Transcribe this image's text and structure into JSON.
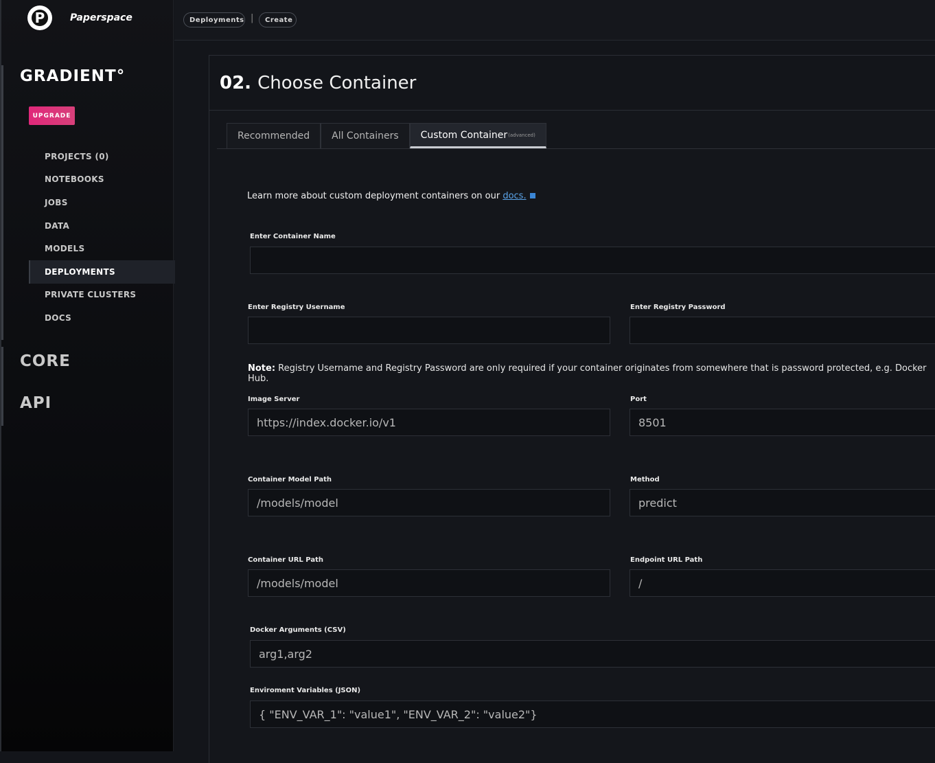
{
  "brand": {
    "name": "Paperspace",
    "logo_letter": "P"
  },
  "sidebar": {
    "product": "GRADIENT°",
    "upgrade_label": "UPGRADE",
    "items": [
      {
        "label": "PROJECTS (0)"
      },
      {
        "label": "NOTEBOOKS"
      },
      {
        "label": "JOBS"
      },
      {
        "label": "DATA"
      },
      {
        "label": "MODELS"
      },
      {
        "label": "DEPLOYMENTS",
        "active": true
      },
      {
        "label": "PRIVATE CLUSTERS"
      },
      {
        "label": "DOCS"
      }
    ],
    "sections": [
      "CORE",
      "API"
    ]
  },
  "breadcrumb": {
    "first": "Deployments",
    "separator": "|",
    "second": "Create"
  },
  "step": {
    "number": "02.",
    "title": "Choose Container"
  },
  "tabs": [
    {
      "label": "Recommended"
    },
    {
      "label": "All Containers"
    },
    {
      "label": "Custom Container",
      "sub": "(advanced)",
      "active": true
    }
  ],
  "intro": {
    "text": "Learn more about custom deployment containers on our ",
    "link": "docs."
  },
  "form": {
    "container_name": {
      "label": "Enter Container Name",
      "value": ""
    },
    "registry_username": {
      "label": "Enter Registry Username",
      "value": ""
    },
    "registry_password": {
      "label": "Enter Registry Password",
      "value": ""
    },
    "note": {
      "bold": "Note:",
      "text": " Registry Username and Registry Password are only required if your container originates from somewhere that is password protected, e.g. Docker Hub."
    },
    "image_server": {
      "label": "Image Server",
      "placeholder": "https://index.docker.io/v1"
    },
    "port": {
      "label": "Port",
      "placeholder": "8501"
    },
    "model_path": {
      "label": "Container Model Path",
      "placeholder": "/models/model"
    },
    "method": {
      "label": "Method",
      "placeholder": "predict"
    },
    "url_path": {
      "label": "Container URL Path",
      "placeholder": "/models/model"
    },
    "endpoint_url_path": {
      "label": "Endpoint URL Path",
      "placeholder": "/"
    },
    "docker_args": {
      "label": "Docker Arguments (CSV)",
      "placeholder": "arg1,arg2"
    },
    "env_vars": {
      "label": "Enviroment Variables (JSON)",
      "placeholder": "{ \"ENV_VAR_1\": \"value1\", \"ENV_VAR_2\": \"value2\"}"
    }
  },
  "colors": {
    "upgrade": "#e0287a",
    "link": "#5aa3e8",
    "background": "#13151a"
  }
}
